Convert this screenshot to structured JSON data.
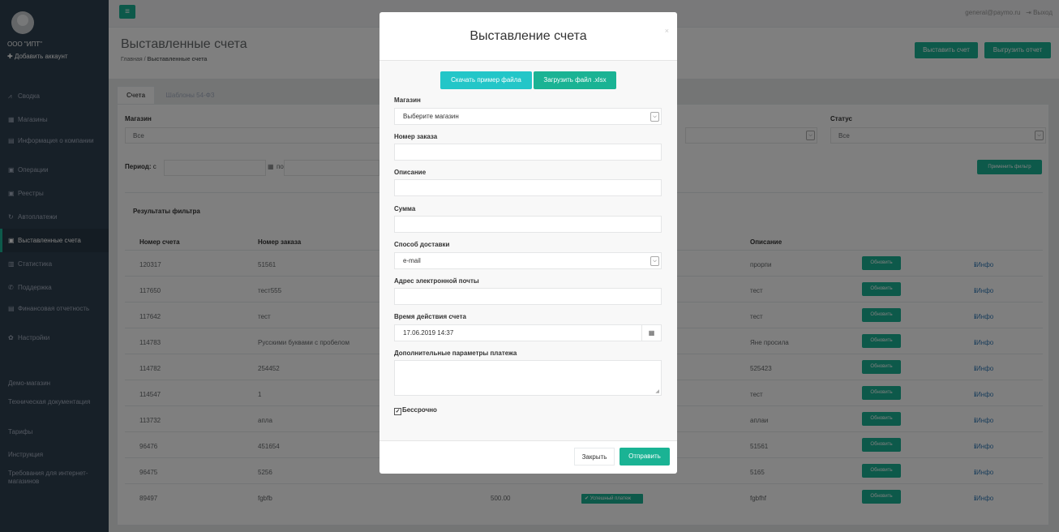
{
  "sidebar": {
    "company": "ООО \"ИПТ\"",
    "add_account": "Добавить аккаунт",
    "menu": [
      {
        "label": "Сводка",
        "icon": "chart-icon"
      },
      {
        "label": "Магазины",
        "icon": "shop-icon"
      },
      {
        "label": "Информация о компании",
        "icon": "document-icon"
      },
      {
        "label": "Операции",
        "icon": "copy-icon"
      },
      {
        "label": "Реестры",
        "icon": "copy-icon"
      },
      {
        "label": "Автоплатежи",
        "icon": "refresh-icon"
      },
      {
        "label": "Выставленные счета",
        "icon": "copy-icon"
      },
      {
        "label": "Статистика",
        "icon": "bar-chart-icon"
      },
      {
        "label": "Поддержка",
        "icon": "phone-icon"
      },
      {
        "label": "Финансовая отчетность",
        "icon": "document-icon"
      },
      {
        "label": "Настройки",
        "icon": "gear-icon"
      }
    ],
    "links": [
      "Демо-магазин",
      "Техническая документация",
      "Тарифы",
      "Инструкция",
      "Требования для интернет-магазинов"
    ]
  },
  "topbar": {
    "burger": "≡",
    "user_email": "general@paymo.ru",
    "logout": "Выход"
  },
  "header": {
    "title": "Выставленные счета",
    "breadcrumb_home": "Главная",
    "breadcrumb_sep": "/",
    "breadcrumb_current": "Выставленные счета",
    "issue_button": "Выставить счет",
    "export_button": "Выгрузить отчет"
  },
  "tabs": [
    {
      "label": "Счета"
    },
    {
      "label": "Шаблоны 54-ФЗ"
    }
  ],
  "filters": {
    "shop_label": "Магазин",
    "shop_value": "Все",
    "status_label": "Статус",
    "status_value": "Все",
    "period_label": "Период:",
    "from_label": "с",
    "to_label": "по",
    "apply_button": "Применить фильтр"
  },
  "results": {
    "title": "Результаты фильтра",
    "columns": {
      "invoice": "Номер счета",
      "order": "Номер заказа",
      "description": "Описание"
    },
    "update_label": "Обновить",
    "info_label": "Инфо",
    "rows": [
      {
        "invoice": "120317",
        "order": "51561",
        "description": "прорпи",
        "amount": "",
        "status": ""
      },
      {
        "invoice": "117650",
        "order": "тест555",
        "description": "тест",
        "amount": "",
        "status": ""
      },
      {
        "invoice": "117642",
        "order": "тест",
        "description": "тест",
        "amount": "",
        "status": ""
      },
      {
        "invoice": "114783",
        "order": "Русскими буквами с пробелом",
        "description": "Яне просила",
        "amount": "",
        "status": ""
      },
      {
        "invoice": "114782",
        "order": "254452",
        "description": "525423",
        "amount": "",
        "status": ""
      },
      {
        "invoice": "114547",
        "order": "1",
        "description": "тест",
        "amount": "",
        "status": ""
      },
      {
        "invoice": "113732",
        "order": "апла",
        "description": "аплаи",
        "amount": "",
        "status": ""
      },
      {
        "invoice": "96476",
        "order": "451654",
        "description": "51561",
        "amount": "",
        "status": ""
      },
      {
        "invoice": "96475",
        "order": "5256",
        "description": "5165",
        "amount": "",
        "status": ""
      },
      {
        "invoice": "89497",
        "order": "fgbfb",
        "description": "fgbfhf",
        "amount": "500.00",
        "status": "✔ Успешный платеж"
      }
    ]
  },
  "modal": {
    "title": "Выставление счета",
    "close": "×",
    "sample_button": "Скачать пример файла",
    "upload_button": "Загрузить файл .xlsx",
    "shop_label": "Магазин",
    "shop_placeholder": "Выберите магазин",
    "order_label": "Номер заказа",
    "description_label": "Описание",
    "sum_label": "Сумма",
    "delivery_label": "Способ доставки",
    "delivery_value": "e-mail",
    "email_label": "Адрес электронной почты",
    "validity_label": "Время действия счета",
    "validity_value": "17.06.2019 14:37",
    "extra_label": "Дополнительные параметры платежа",
    "perpetual_label": "Бессрочно",
    "perpetual_checked": true,
    "close_button": "Закрыть",
    "send_button": "Отправить"
  }
}
